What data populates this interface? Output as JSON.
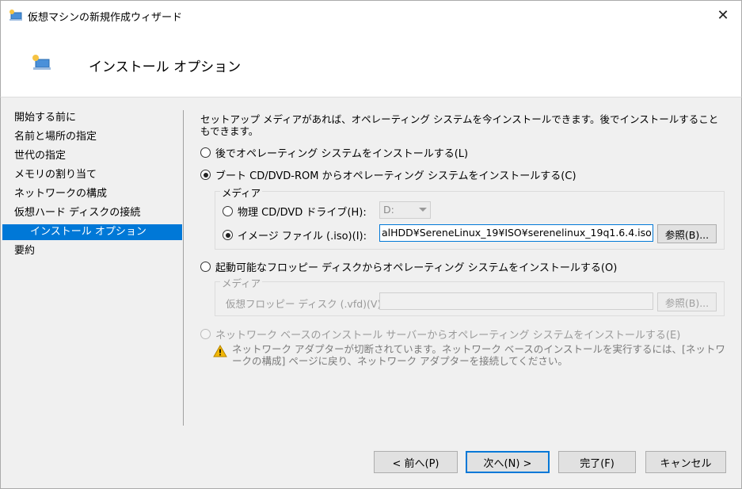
{
  "window": {
    "title": "仮想マシンの新規作成ウィザード",
    "close_label": "✕"
  },
  "header": {
    "title": "インストール オプション"
  },
  "nav": {
    "items": [
      {
        "label": "開始する前に"
      },
      {
        "label": "名前と場所の指定"
      },
      {
        "label": "世代の指定"
      },
      {
        "label": "メモリの割り当て"
      },
      {
        "label": "ネットワークの構成"
      },
      {
        "label": "仮想ハード ディスクの接続"
      },
      {
        "label": "インストール オプション",
        "active": true
      },
      {
        "label": "要約"
      }
    ]
  },
  "content": {
    "description": "セットアップ メディアがあれば、オペレーティング システムを今インストールできます。後でインストールすることもできます。",
    "option_later": "後でオペレーティング システムをインストールする(L)",
    "option_boot_cd": "ブート CD/DVD-ROM からオペレーティング システムをインストールする(C)",
    "media_group_label": "メディア",
    "physical_drive_label": "物理 CD/DVD ドライブ(H):",
    "physical_drive_value": "D:",
    "image_file_label": "イメージ ファイル (.iso)(I):",
    "image_file_value": "alHDD¥SereneLinux_19¥ISO¥serenelinux_19q1.6.4.iso",
    "browse_label": "参照(B)...",
    "option_floppy": "起動可能なフロッピー ディスクからオペレーティング システムをインストールする(O)",
    "floppy_group_label": "メディア",
    "virtual_floppy_label": "仮想フロッピー ディスク (.vfd)(V):",
    "virtual_floppy_value": "",
    "floppy_browse_label": "参照(B)...",
    "option_network": "ネットワーク ベースのインストール サーバーからオペレーティング システムをインストールする(E)",
    "network_warning": "ネットワーク アダプターが切断されています。ネットワーク ベースのインストールを実行するには、[ネットワークの構成] ページに戻り、ネットワーク アダプターを接続してください。"
  },
  "footer": {
    "back_label": "< 前へ(P)",
    "next_label": "次へ(N) >",
    "finish_label": "完了(F)",
    "cancel_label": "キャンセル"
  },
  "colors": {
    "accent": "#0078d7",
    "panel_bg": "#f0f0f0"
  }
}
